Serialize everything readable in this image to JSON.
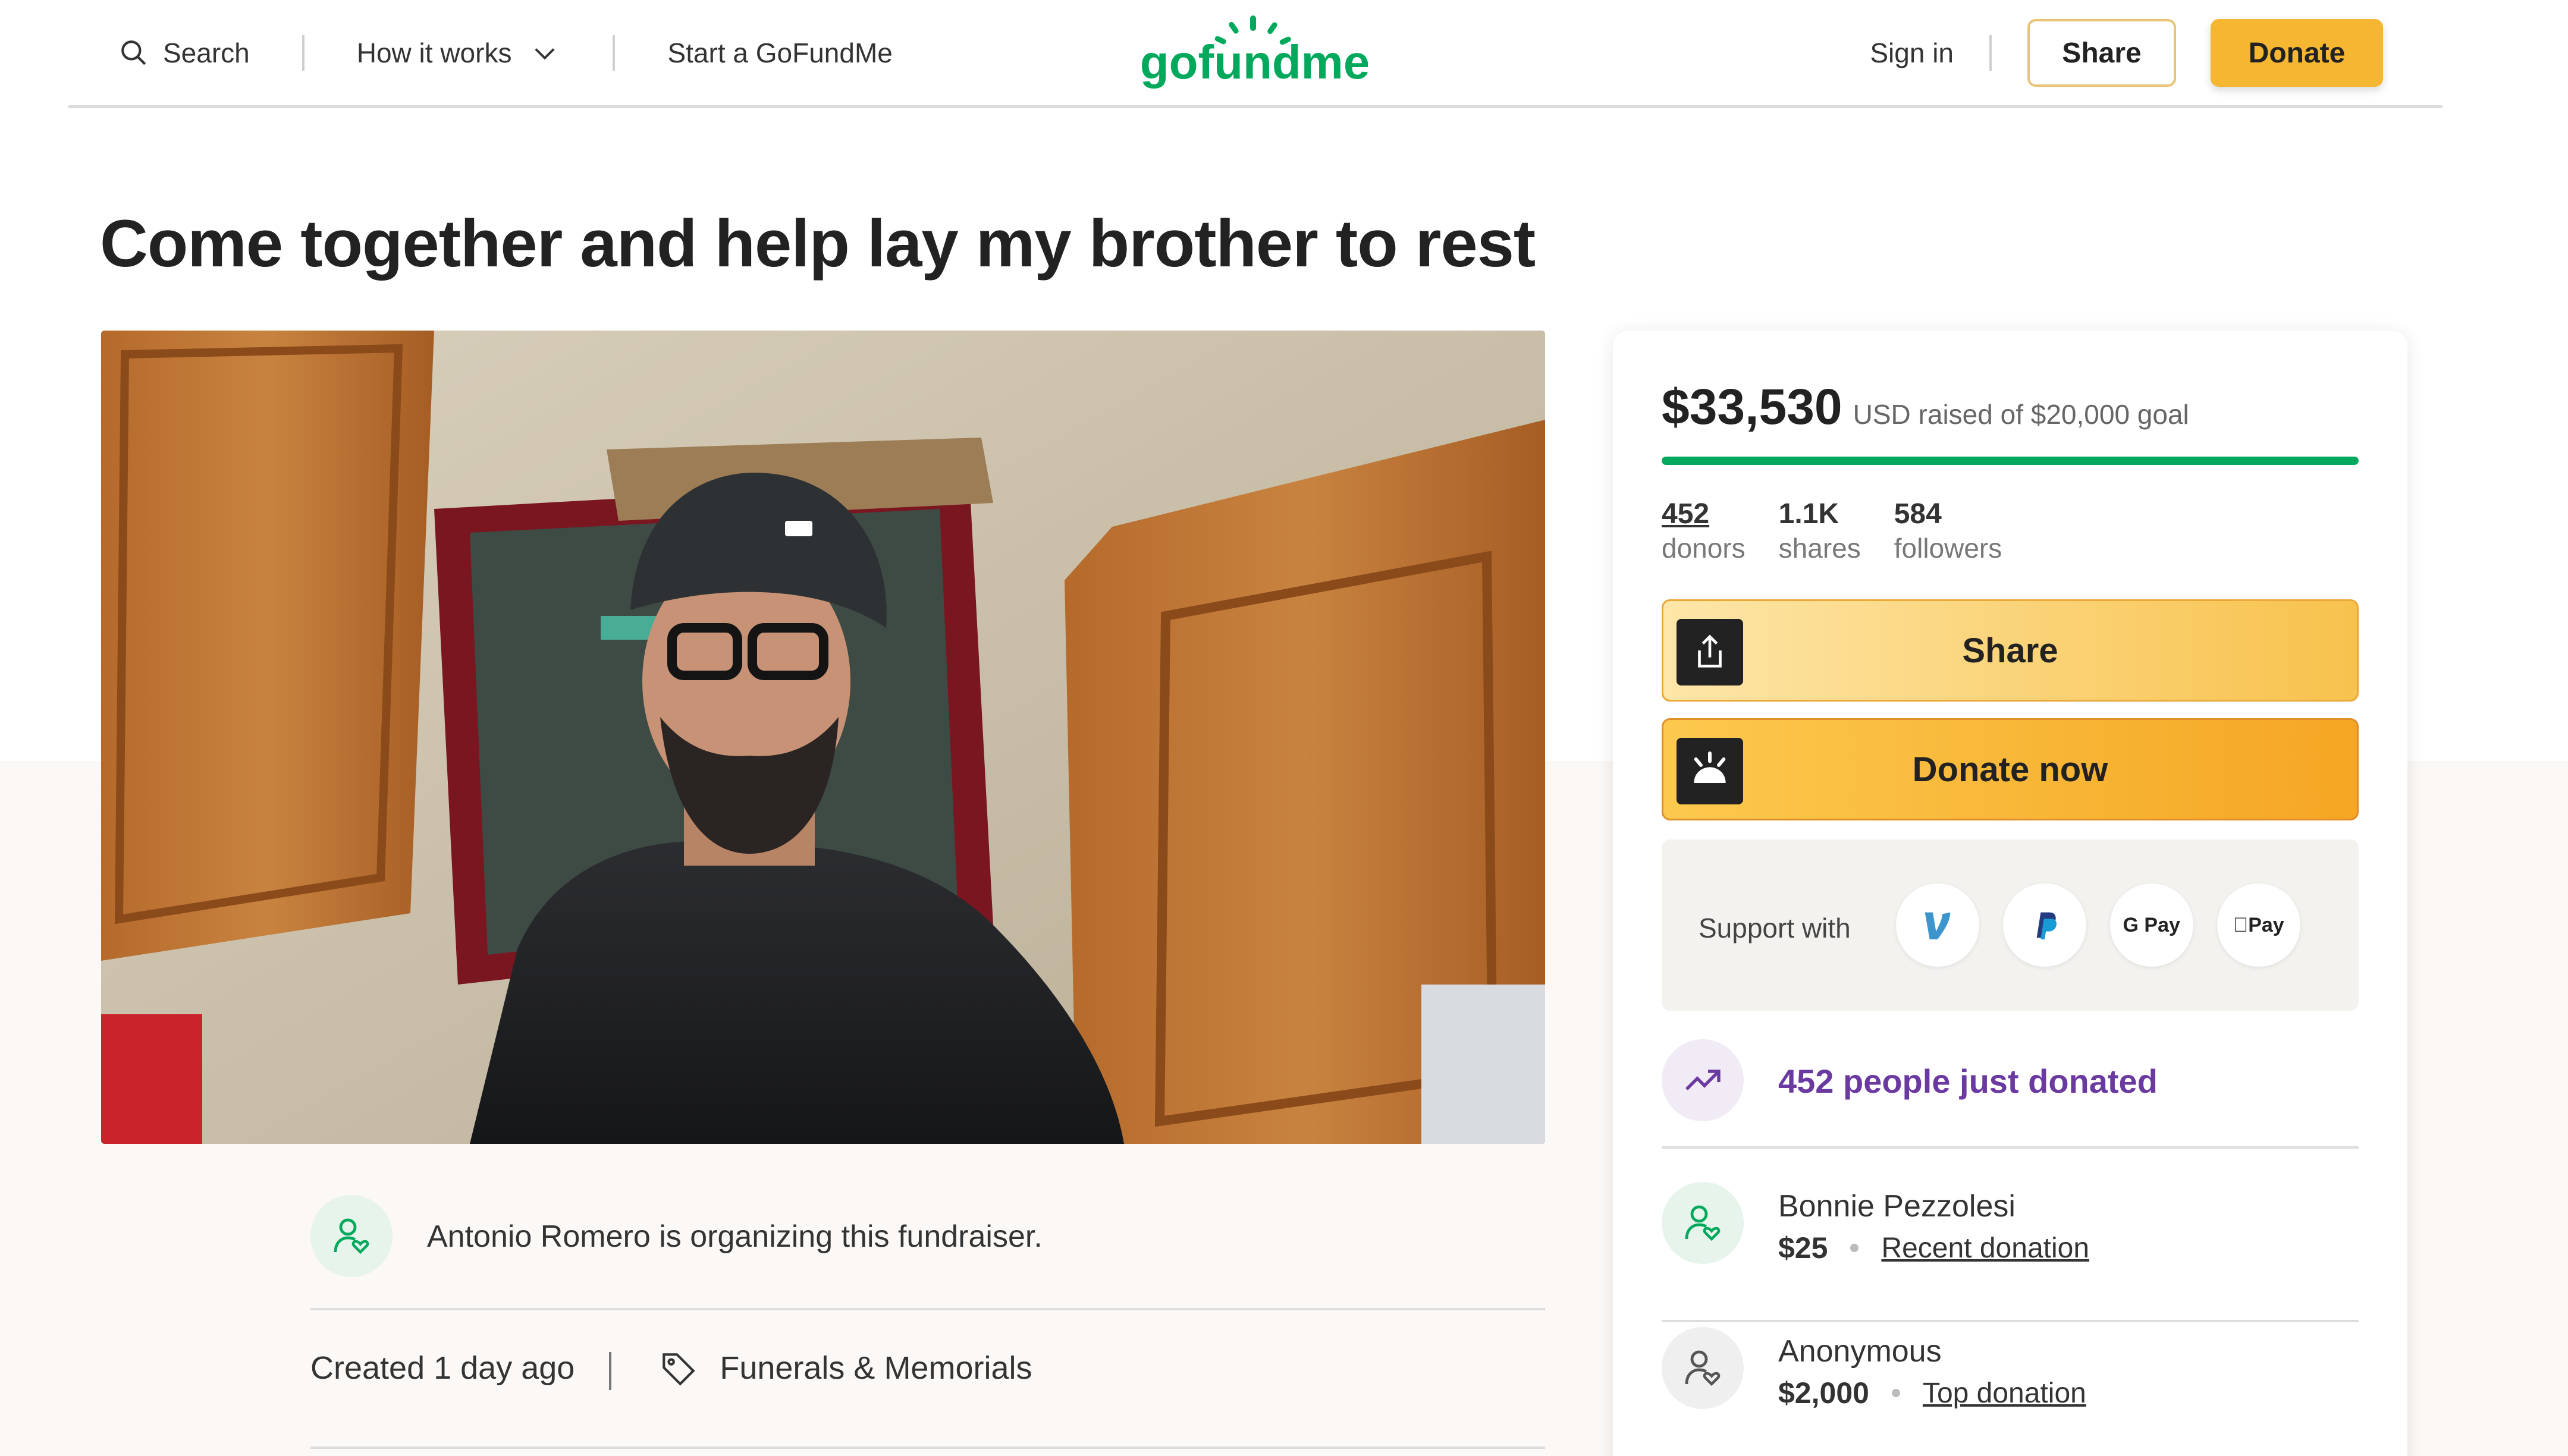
{
  "header": {
    "search_label": "Search",
    "how_it_works_label": "How it works",
    "start_label": "Start a GoFundMe",
    "logo_text": "gofundme",
    "signin_label": "Sign in",
    "share_label": "Share",
    "donate_label": "Donate",
    "brand_color": "#02a95c",
    "accent_color": "#f5b731"
  },
  "campaign": {
    "title": "Come together and help lay my brother to rest",
    "organizer_text": "Antonio Romero is organizing this fundraiser.",
    "created": "Created 1 day ago",
    "category": "Funerals & Memorials"
  },
  "card": {
    "raised_amount": "$33,530",
    "raised_sub": "USD raised of $20,000 goal",
    "progress_fraction": 1.0,
    "stats": [
      {
        "num": "452",
        "label": "donors"
      },
      {
        "num": "1.1K",
        "label": "shares"
      },
      {
        "num": "584",
        "label": "followers"
      }
    ],
    "share_button": "Share",
    "donate_button": "Donate now",
    "support_label": "Support with",
    "payment_methods": [
      "venmo-icon",
      "paypal-icon",
      "gpay-icon",
      "applepay-icon"
    ],
    "gpay_text": "G Pay",
    "applepay_text": "Pay",
    "just_donated": "452 people just donated",
    "donations": [
      {
        "name": "Bonnie Pezzolesi",
        "amount": "$25",
        "tag": "Recent donation"
      },
      {
        "name": "Anonymous",
        "amount": "$2,000",
        "tag": "Top donation"
      }
    ]
  }
}
